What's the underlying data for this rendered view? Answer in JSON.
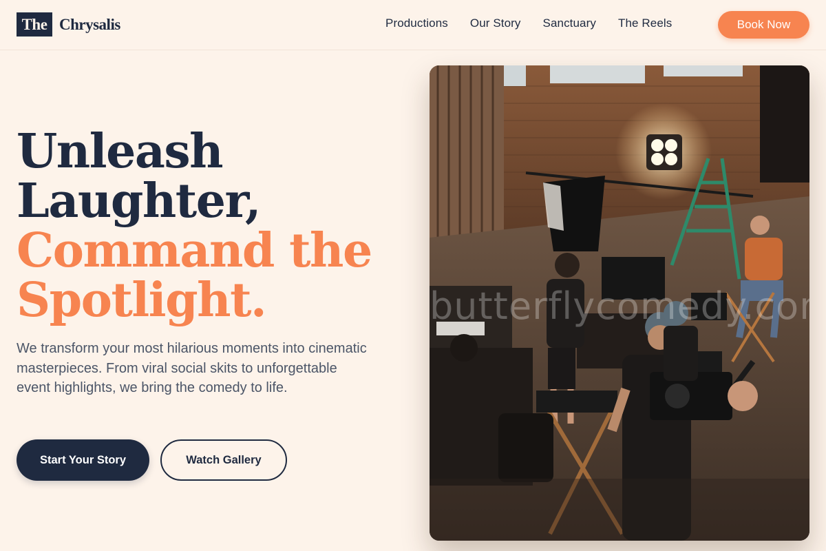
{
  "brand": {
    "logo_mark": "The",
    "logo_word": "Chrysalis"
  },
  "nav": {
    "items": [
      {
        "label": "Productions"
      },
      {
        "label": "Our Story"
      },
      {
        "label": "Sanctuary"
      },
      {
        "label": "The Reels"
      }
    ],
    "cta_label": "Book Now"
  },
  "hero": {
    "title_line1": "Unleash",
    "title_line2": "Laughter,",
    "title_line3": "Command the",
    "title_line4": "Spotlight.",
    "subtitle": "We transform your most hilarious moments into cinematic masterpieces. From viral social skits to unforgettable event highlights, we bring the comedy to life.",
    "primary_button": "Start Your Story",
    "secondary_button": "Watch Gallery",
    "image_watermark": "butterflycomedy.com"
  },
  "colors": {
    "background": "#fdf3ea",
    "navy": "#1f2a40",
    "accent": "#f78450",
    "body_text": "#4b5567"
  }
}
